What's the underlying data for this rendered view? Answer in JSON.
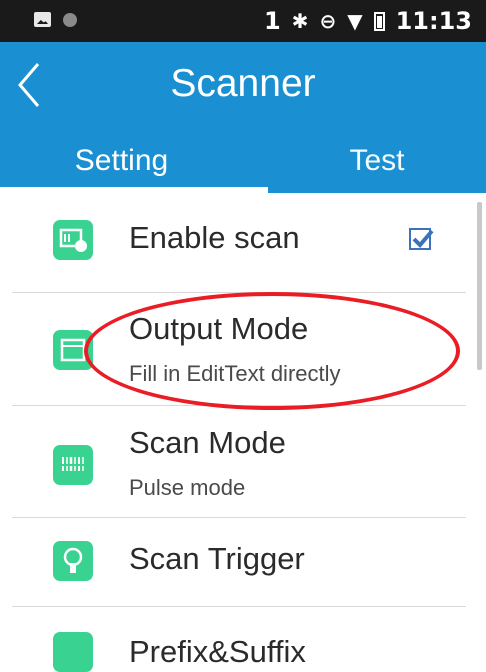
{
  "status_bar": {
    "sim": "1",
    "bluetooth_icon": "bluetooth-icon",
    "dnd_icon": "dnd-icon",
    "wifi_icon": "wifi-icon",
    "battery_icon": "battery-icon",
    "time": "11:13"
  },
  "app_bar": {
    "title": "Scanner",
    "back_icon": "chevron-left-icon"
  },
  "tabs": [
    {
      "label": "Setting",
      "active": true
    },
    {
      "label": "Test",
      "active": false
    }
  ],
  "settings": [
    {
      "title": "Enable scan",
      "icon": "scan-settings-icon",
      "checked": true
    },
    {
      "title": "Output Mode",
      "subtitle": "Fill in EditText directly",
      "icon": "output-mode-icon"
    },
    {
      "title": "Scan Mode",
      "subtitle": "Pulse mode",
      "icon": "barcode-icon"
    },
    {
      "title": "Scan Trigger",
      "icon": "trigger-icon"
    },
    {
      "title": "Prefix&Suffix",
      "icon": "prefix-suffix-icon"
    }
  ],
  "colors": {
    "app_bar": "#1a8fd2",
    "icon_green": "#39d291",
    "highlight": "#ea1c24"
  }
}
